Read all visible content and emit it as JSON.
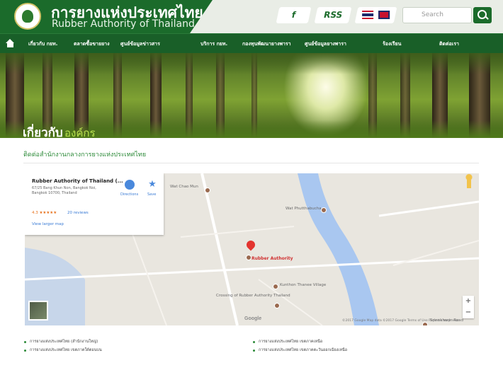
{
  "header": {
    "org_name_th": "การยางแห่งประเทศไทย",
    "org_name_en": "Rubber Authority of Thailand",
    "social": {
      "facebook": "f",
      "rss": "RSS"
    },
    "search": {
      "placeholder": "Search"
    }
  },
  "nav": {
    "items": [
      "เกี่ยวกับ กยท.",
      "ตลาดซื้อขายยาง",
      "ศูนย์ข้อมูลข่าวสาร",
      "บริการ กยท.",
      "กองทุนพัฒนายางพารา",
      "ศูนย์ข้อมูลยางพารา",
      "ร้องเรียน",
      "ติดต่อเรา"
    ]
  },
  "banner": {
    "title": "เกี่ยวกับ",
    "subtitle": "องค์กร"
  },
  "page": {
    "heading": "ติดต่อสำนักงานกลางการยางแห่งประเทศไทย"
  },
  "map": {
    "card": {
      "title": "Rubber Authority of Thailand (...",
      "address": "67/25 Bang Khun Non, Bangkok Noi, Bangkok 10700, Thailand",
      "rating": "4.3 ★★★★★",
      "reviews": "20 reviews",
      "directions": "Directions",
      "save": "Save",
      "larger_map": "View larger map"
    },
    "pin_label": "Rubber Authority",
    "pois": [
      "Wat Chao Mun",
      "Wat Phutthabucha",
      "Kunthon Thanee Village",
      "Crossing of Rubber Authority Thailand",
      "Srinakharin Road"
    ],
    "google": "Google",
    "attribution": "©2017 Google  Map data ©2017 Google  Terms of Use  Report a map error",
    "zoom": {
      "in": "+",
      "out": "−"
    }
  },
  "links": {
    "left": [
      "การยางแห่งประเทศไทย (สำนักงานใหญ่)",
      "การยางแห่งประเทศไทย เขตภาคใต้ตอนบน"
    ],
    "right": [
      "การยางแห่งประเทศไทย เขตภาคเหนือ",
      "การยางแห่งประเทศไทย เขตภาคตะวันออกเฉียงเหนือ"
    ]
  }
}
